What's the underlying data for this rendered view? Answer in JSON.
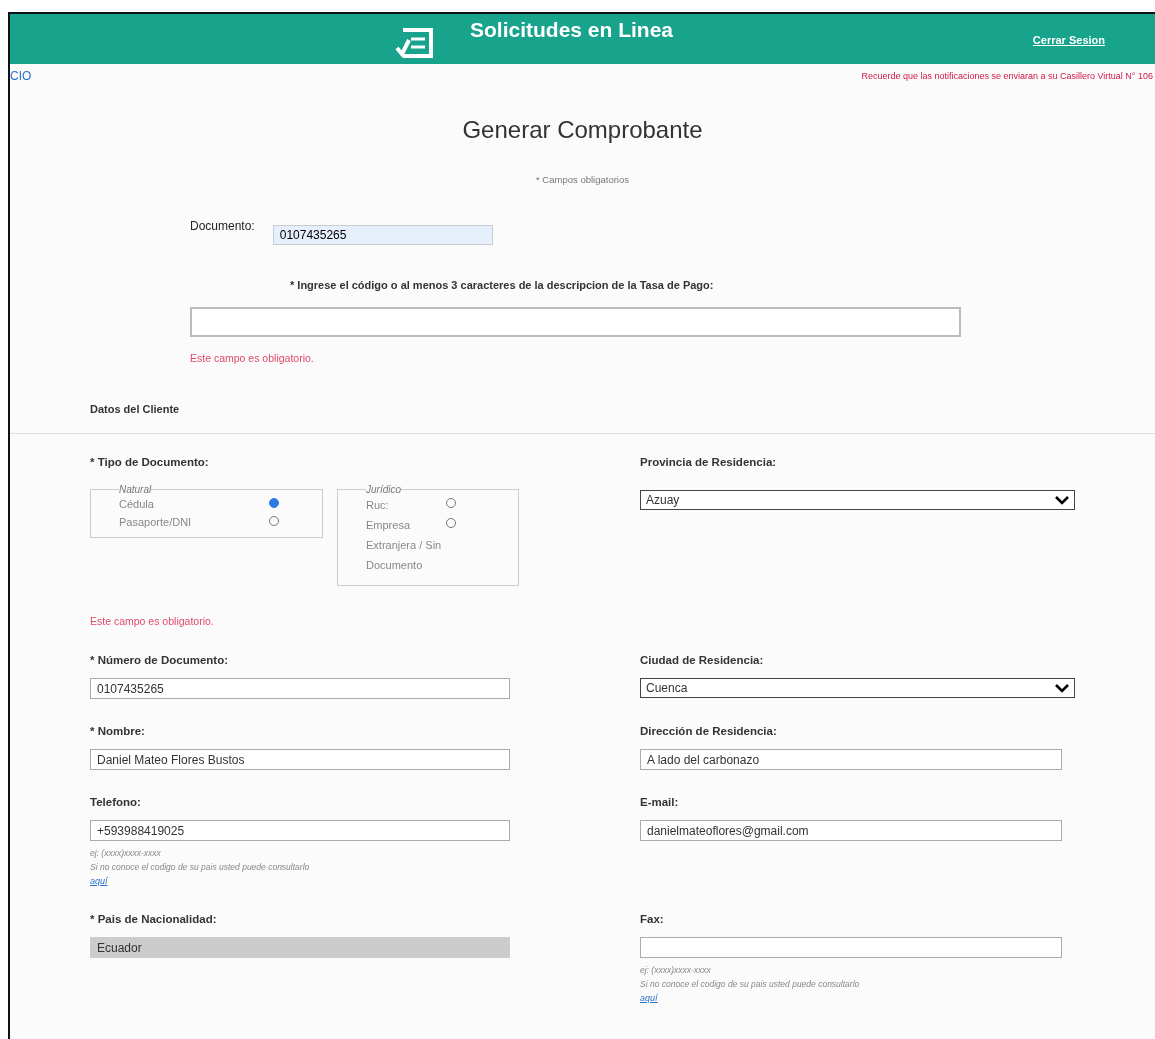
{
  "header": {
    "title": "Solicitudes en Linea",
    "logout_link": "Cerrar Sesion"
  },
  "subbar": {
    "breadcrumb": "CIO",
    "notice": "Recuerde que las notificaciones se enviaran a su Casillero Virtual N° 106"
  },
  "form": {
    "title": "Generar Comprobante",
    "required_note": "* Campos obligatorios",
    "document": {
      "label": "Documento:",
      "value": "0107435265"
    },
    "fee_search": {
      "label": "* Ingrese el código o al menos 3 caracteres de la descripcion de la Tasa de Pago:",
      "error": "Este campo es obligatorio."
    },
    "section_title": "Datos del Cliente",
    "rows": [
      {
        "left": {
          "kind": "radio_group",
          "label": "* Tipo de Documento:",
          "groups": [
            {
              "legend": "Natural",
              "options": [
                {
                  "label": "Cédula",
                  "selected": true
                },
                {
                  "label": "Pasaporte/DNI",
                  "selected": false
                }
              ]
            },
            {
              "legend": "Jurídico",
              "options": [
                {
                  "label": "Ruc:",
                  "selected": false
                },
                {
                  "label": "Empresa Extranjera / Sin Documento",
                  "selected": false
                }
              ]
            }
          ],
          "error": "Este campo es obligatorio."
        },
        "right": {
          "kind": "select",
          "label": "Provincia de Residencia:",
          "value": "Azuay"
        }
      },
      {
        "left": {
          "kind": "text",
          "label": "* Número de Documento:",
          "value": "0107435265"
        },
        "right": {
          "kind": "select",
          "label": "Ciudad de Residencia:",
          "value": "Cuenca"
        }
      },
      {
        "left": {
          "kind": "text",
          "label": "* Nombre:",
          "value": "Daniel Mateo Flores Bustos"
        },
        "right": {
          "kind": "text",
          "label": "Dirección de Residencia:",
          "value": "A lado del carbonazo"
        }
      },
      {
        "left": {
          "kind": "text",
          "label": "Telefono:",
          "value": "+593988419025",
          "hint": "ej: (xxxx)xxxx-xxxx",
          "help": "Si no conoce el codigo de su pais usted puede consultarlo",
          "link": "aquí"
        },
        "right": {
          "kind": "text",
          "label": "E-mail:",
          "value": "danielmateoflores@gmail.com"
        }
      },
      {
        "left": {
          "kind": "readonly",
          "label": "* Pais de Nacionalidad:",
          "value": "Ecuador"
        },
        "right": {
          "kind": "text",
          "label": "Fax:",
          "hint": "ej: (xxxx)xxxx-xxxx",
          "help": "Si no conoce el codigo de su pais usted puede consultarlo",
          "link": "aquí"
        }
      }
    ]
  }
}
